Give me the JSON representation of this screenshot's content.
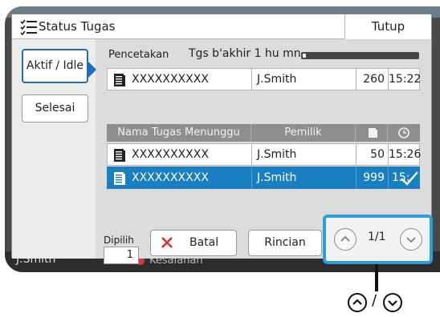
{
  "background": {
    "user_name": "J.Smith",
    "error_text": "Kesalahan"
  },
  "dialog": {
    "title": "Status Tugas",
    "close_label": "Tutup"
  },
  "sidebar": {
    "tabs": [
      {
        "label": "Aktif / Idle",
        "active": true
      },
      {
        "label": "Selesai",
        "active": false
      }
    ]
  },
  "printing": {
    "label": "Pencetakan",
    "finish_text": "Tgs b'akhir 1 hu mn",
    "progress_fraction": 0.03,
    "job": {
      "name": "XXXXXXXXXX",
      "owner": "J.Smith",
      "pages": "260",
      "time": "15:22"
    }
  },
  "waiting": {
    "headers": {
      "name": "Nama Tugas Menunggu",
      "owner": "Pemilik"
    },
    "jobs": [
      {
        "name": "XXXXXXXXXX",
        "owner": "J.Smith",
        "pages": "50",
        "time": "15:26",
        "selected": false
      },
      {
        "name": "XXXXXXXXXX",
        "owner": "J.Smith",
        "pages": "999",
        "time": "15:",
        "selected": true
      }
    ]
  },
  "footer": {
    "selected_label": "Dipilih",
    "selected_count": "1",
    "cancel_label": "Batal",
    "details_label": "Rincian",
    "page_indicator": "1/1"
  },
  "colors": {
    "accent": "#1a7fc1",
    "highlight_box": "#2d9fd8",
    "cancel_x": "#e03030"
  },
  "callout": {
    "separator": "/"
  }
}
